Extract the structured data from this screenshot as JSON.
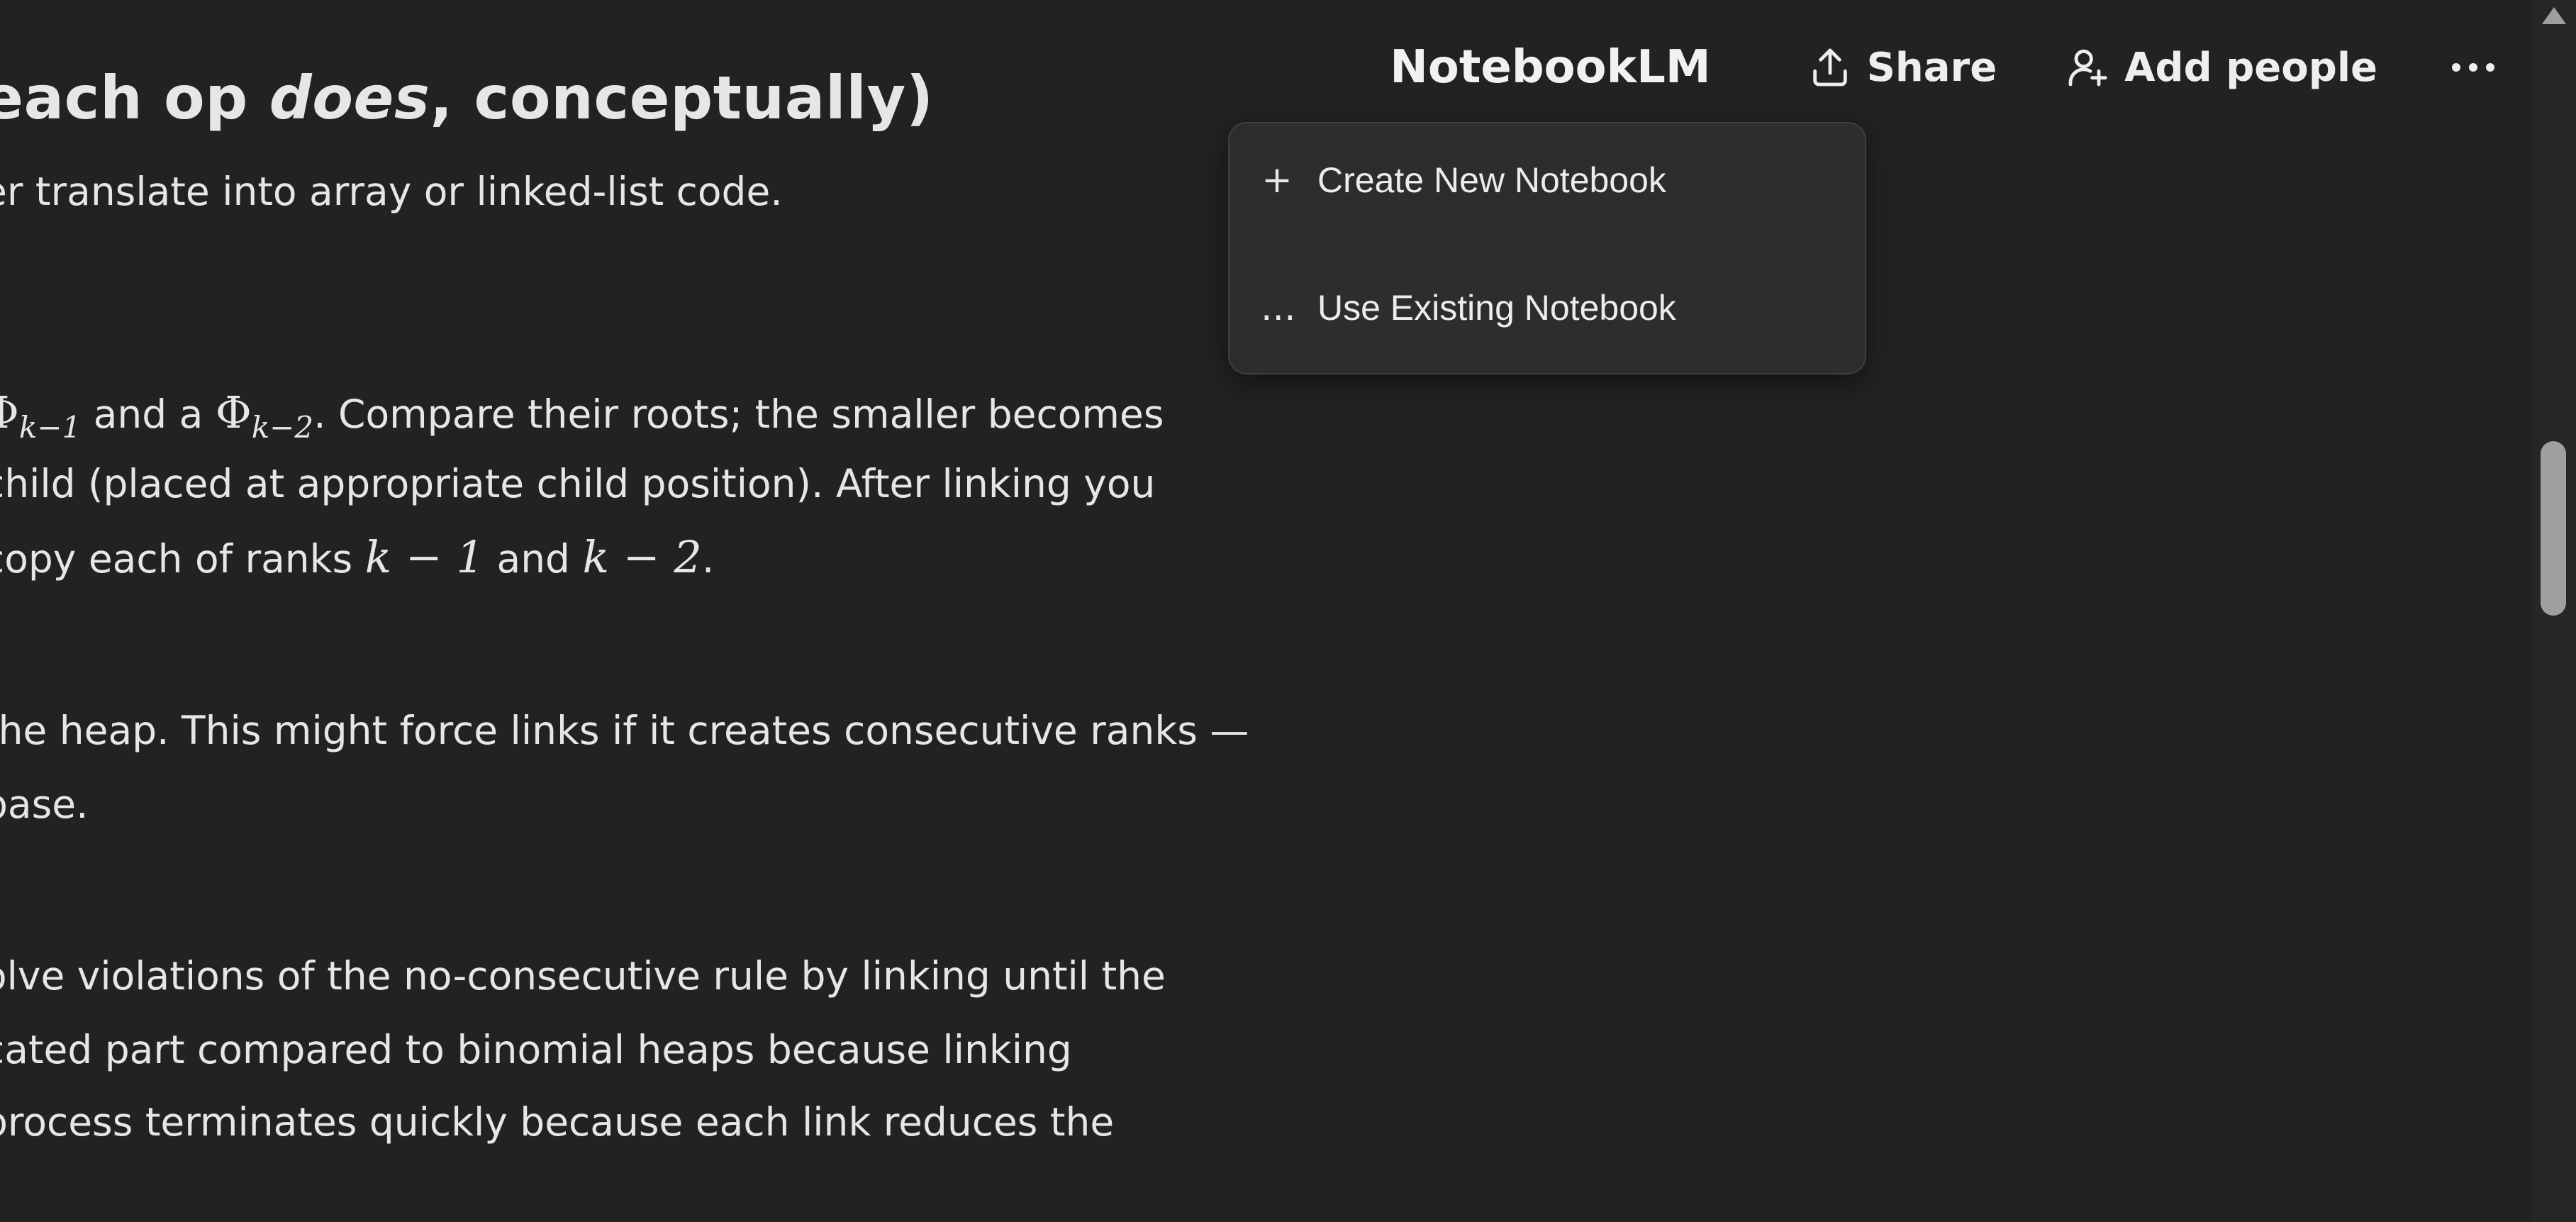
{
  "header": {
    "brand": "NotebookLM",
    "share_label": "Share",
    "add_people_label": "Add people"
  },
  "menu": {
    "items": [
      {
        "icon": "+",
        "label": "Create New Notebook"
      },
      {
        "icon": "...",
        "label": "Use Existing Notebook"
      }
    ]
  },
  "article": {
    "heading_pre": "each op ",
    "heading_em": "does",
    "heading_post": ", conceptually)",
    "l1": "er translate into array or linked-list code.",
    "l2_a": " and a ",
    "l2_b": ". Compare their roots; the smaller becomes",
    "l3": "child (placed at appropriate child position). After linking you",
    "l4_a": "copy each of ranks ",
    "l4_b": " and ",
    "l4_c": ".",
    "l5": "the heap. This might force links if it creates consecutive ranks —",
    "l6": "base.",
    "l7": "olve violations of the no-consecutive rule by linking until the",
    "l8": "cated part compared to binomial heaps because linking",
    "l9": "process terminates quickly because each link reduces the",
    "math": {
      "phi": "Φ",
      "sub_k1": "k−1",
      "sub_k2": "k−2",
      "k1": "k − 1",
      "k2": "k − 2"
    }
  }
}
